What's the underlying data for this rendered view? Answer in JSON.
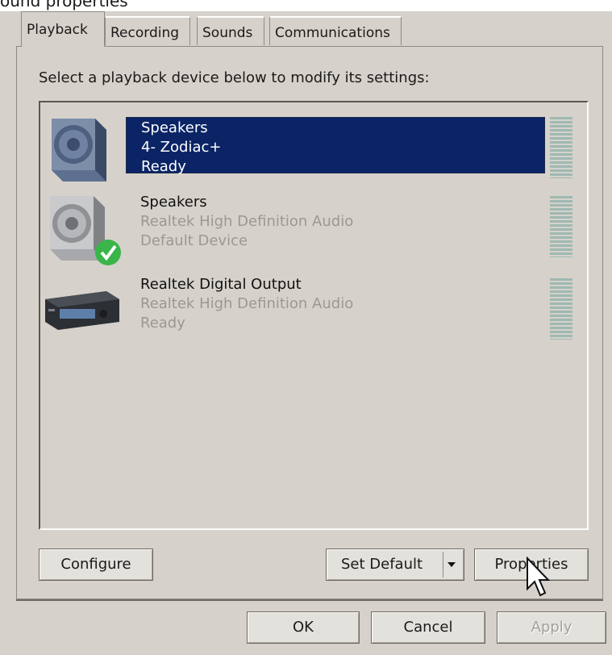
{
  "window": {
    "title_fragment": "ound properties"
  },
  "tabs": [
    {
      "label": "Playback",
      "active": true
    },
    {
      "label": "Recording",
      "active": false
    },
    {
      "label": "Sounds",
      "active": false
    },
    {
      "label": "Communications",
      "active": false
    }
  ],
  "instruction": "Select a playback device below to modify its settings:",
  "devices": [
    {
      "name": "Speakers",
      "description": "4- Zodiac+",
      "status": "Ready",
      "icon": "speaker-icon",
      "selected": true
    },
    {
      "name": "Speakers",
      "description": "Realtek High Definition Audio",
      "status": "Default Device",
      "icon": "speaker-default-icon",
      "selected": false
    },
    {
      "name": "Realtek Digital Output",
      "description": "Realtek High Definition Audio",
      "status": "Ready",
      "icon": "digital-output-icon",
      "selected": false
    }
  ],
  "buttons": {
    "configure": "Configure",
    "set_default": "Set Default",
    "properties": "Properties",
    "ok": "OK",
    "cancel": "Cancel",
    "apply": "Apply"
  },
  "colors": {
    "dialog_bg": "#d6d2cb",
    "selection_bg": "#0a2466",
    "level_meter": "#9fb9b2",
    "default_check": "#3ab54a"
  }
}
